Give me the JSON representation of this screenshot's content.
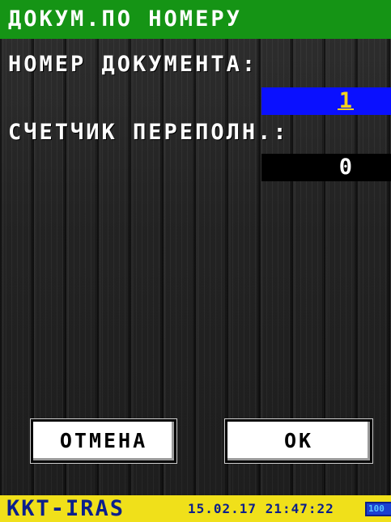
{
  "screen": {
    "title": "ДОКУМ.ПО НОМЕРУ"
  },
  "form": {
    "doc_number_label": "НОМЕР ДОКУМЕНТА:",
    "doc_number_value": "1",
    "overflow_label": "СЧЕТЧИК ПЕРЕПОЛН.:",
    "overflow_value": "0"
  },
  "buttons": {
    "cancel_label": "ОТМЕНА",
    "ok_label": "ОК"
  },
  "status": {
    "device_name": "KKT-IRAS",
    "datetime": "15.02.17 21:47:22",
    "battery_level": "100"
  },
  "colors": {
    "title_bar": "#159415",
    "input_active": "#0a10ff",
    "input_value": "#f5d21c",
    "input_inactive": "#000000",
    "status_bar": "#f0e01a",
    "status_text": "#0b1f8c"
  }
}
